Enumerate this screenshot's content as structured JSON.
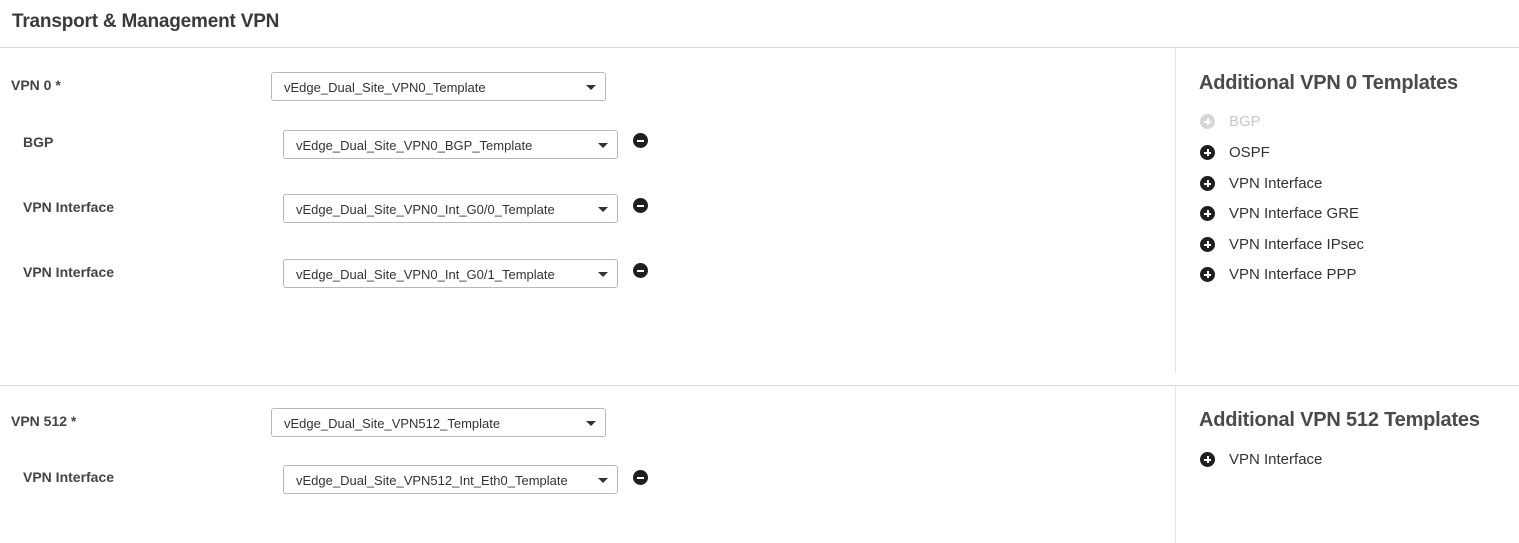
{
  "page": {
    "title": "Transport & Management VPN"
  },
  "vpn0": {
    "label": "VPN 0 *",
    "template": "vEdge_Dual_Site_VPN0_Template",
    "subs": [
      {
        "label": "BGP",
        "template": "vEdge_Dual_Site_VPN0_BGP_Template"
      },
      {
        "label": "VPN Interface",
        "template": "vEdge_Dual_Site_VPN0_Int_G0/0_Template"
      },
      {
        "label": "VPN Interface",
        "template": "vEdge_Dual_Site_VPN0_Int_G0/1_Template"
      }
    ],
    "additional": {
      "title": "Additional VPN 0 Templates",
      "items": [
        {
          "label": "BGP",
          "enabled": false
        },
        {
          "label": "OSPF",
          "enabled": true
        },
        {
          "label": "VPN Interface",
          "enabled": true
        },
        {
          "label": "VPN Interface GRE",
          "enabled": true
        },
        {
          "label": "VPN Interface IPsec",
          "enabled": true
        },
        {
          "label": "VPN Interface PPP",
          "enabled": true
        }
      ]
    }
  },
  "vpn512": {
    "label": "VPN 512 *",
    "template": "vEdge_Dual_Site_VPN512_Template",
    "subs": [
      {
        "label": "VPN Interface",
        "template": "vEdge_Dual_Site_VPN512_Int_Eth0_Template"
      }
    ],
    "additional": {
      "title": "Additional VPN 512 Templates",
      "items": [
        {
          "label": "VPN Interface",
          "enabled": true
        }
      ]
    }
  },
  "icons": {
    "add": "plus-circle-icon",
    "remove": "minus-circle-icon",
    "dropdown": "caret-down-icon"
  },
  "colors": {
    "icon_dark": "#1f1f1f",
    "icon_disabled": "#d6d6d6",
    "divider": "#d9d9d9"
  }
}
